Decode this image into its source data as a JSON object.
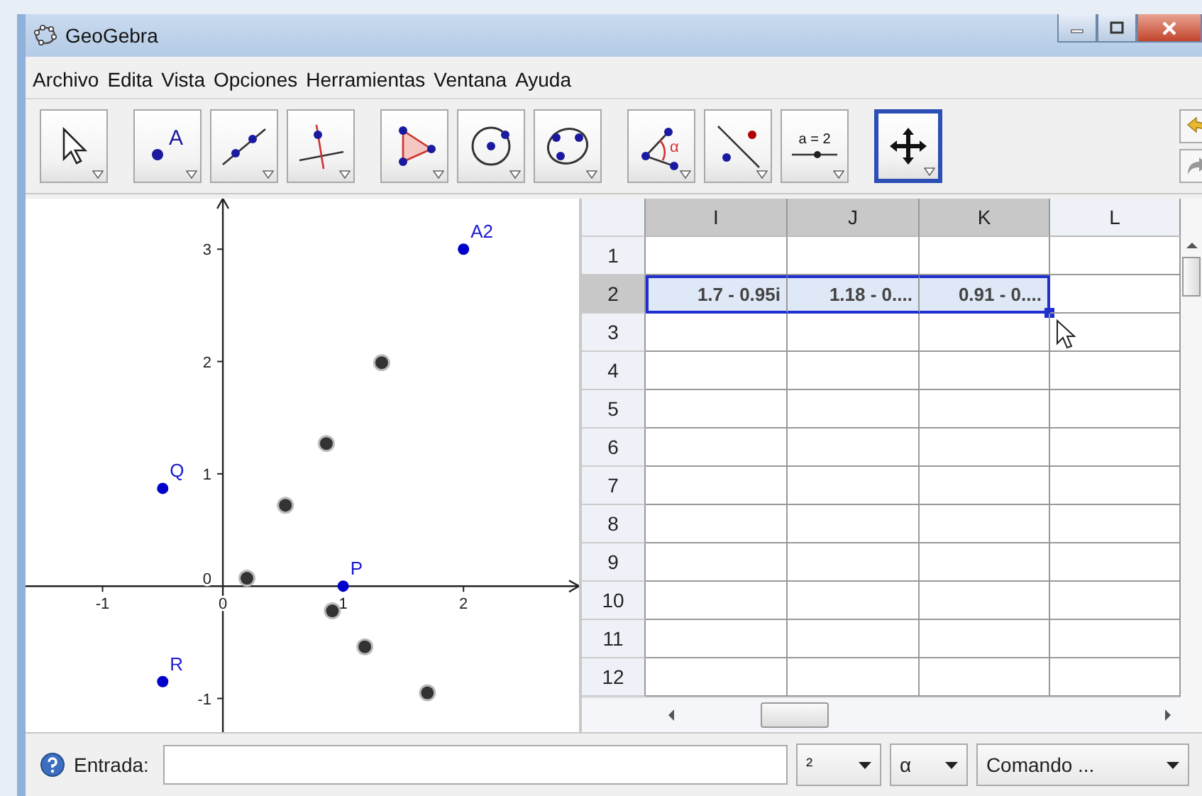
{
  "window": {
    "title": "GeoGebra"
  },
  "menu": [
    "Archivo",
    "Edita",
    "Vista",
    "Opciones",
    "Herramientas",
    "Ventana",
    "Ayuda"
  ],
  "toolbar": {
    "tools": [
      {
        "kind": "move",
        "selected": false
      },
      {
        "kind": "point",
        "label": "A",
        "selected": false
      },
      {
        "kind": "line",
        "selected": false
      },
      {
        "kind": "perpendicular",
        "selected": false
      },
      {
        "kind": "polygon",
        "selected": false
      },
      {
        "kind": "circle",
        "selected": false
      },
      {
        "kind": "conic",
        "selected": false
      },
      {
        "kind": "angle",
        "label": "α",
        "selected": false
      },
      {
        "kind": "reflect",
        "selected": false
      },
      {
        "kind": "slider",
        "label": "a = 2",
        "selected": false
      },
      {
        "kind": "pan",
        "selected": true
      }
    ]
  },
  "graphics": {
    "chart_data": {
      "type": "scatter",
      "xlim": [
        -1.64,
        2.96
      ],
      "ylim": [
        -1.3,
        3.45
      ],
      "xticks": [
        -1,
        0,
        1,
        2
      ],
      "yticks": [
        -1,
        0,
        1,
        2,
        3
      ],
      "series": [
        {
          "color": "#0000cc",
          "x": [
            2,
            1,
            -0.5,
            -0.5
          ],
          "values": [
            3,
            0,
            0.87,
            -0.85
          ]
        },
        {
          "color": "#333333",
          "x": [
            0.2,
            0.52,
            0.86,
            1.32,
            0.91,
            1.18,
            1.7
          ],
          "values": [
            0.07,
            0.72,
            1.27,
            1.99,
            -0.22,
            -0.54,
            -0.95
          ]
        }
      ],
      "annotations": [
        {
          "x": 2,
          "y": 3,
          "text": "A2"
        },
        {
          "x": 1,
          "y": 0,
          "text": "P"
        },
        {
          "x": -0.5,
          "y": 0.87,
          "text": "Q"
        },
        {
          "x": -0.5,
          "y": -0.85,
          "text": "R"
        }
      ]
    }
  },
  "spreadsheet": {
    "columns": [
      {
        "label": "I",
        "selected": true
      },
      {
        "label": "J",
        "selected": true
      },
      {
        "label": "K",
        "selected": true
      },
      {
        "label": "L",
        "selected": false
      }
    ],
    "rows": [
      {
        "label": "1",
        "selected": false
      },
      {
        "label": "2",
        "selected": true,
        "cells": [
          "1.7 - 0.95i",
          "1.18 - 0....",
          "0.91 - 0...."
        ]
      },
      {
        "label": "3",
        "selected": false
      },
      {
        "label": "4",
        "selected": false
      },
      {
        "label": "5",
        "selected": false
      },
      {
        "label": "6",
        "selected": false
      },
      {
        "label": "7",
        "selected": false
      },
      {
        "label": "8",
        "selected": false
      },
      {
        "label": "9",
        "selected": false
      },
      {
        "label": "10",
        "selected": false
      },
      {
        "label": "11",
        "selected": false
      },
      {
        "label": "12",
        "selected": false
      }
    ]
  },
  "input_bar": {
    "label": "Entrada:",
    "dropdowns": [
      "²",
      "α",
      "Comando ..."
    ]
  }
}
